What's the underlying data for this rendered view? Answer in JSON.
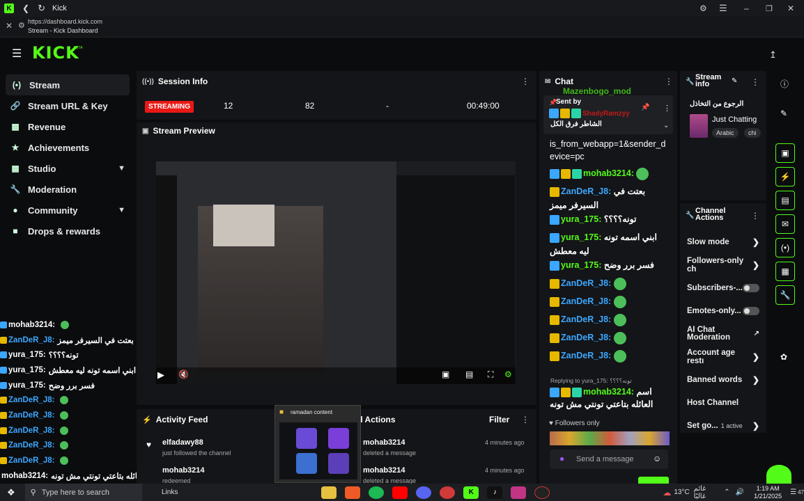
{
  "browser": {
    "tab_title": "Kick",
    "url": "https://dashboard.kick.com",
    "page_title": "Stream - Kick Dashboard"
  },
  "brand": {
    "logo": "KICK",
    "beta": "BETA",
    "accent": "#53fc18"
  },
  "sidebar": {
    "items": [
      {
        "label": "Stream",
        "icon": "broadcast-icon"
      },
      {
        "label": "Stream URL & Key",
        "icon": "link-icon"
      },
      {
        "label": "Revenue",
        "icon": "chart-icon"
      },
      {
        "label": "Achievements",
        "icon": "trophy-icon"
      },
      {
        "label": "Studio",
        "icon": "grid-icon"
      },
      {
        "label": "Moderation",
        "icon": "wrench-icon"
      },
      {
        "label": "Community",
        "icon": "users-icon"
      },
      {
        "label": "Drops & rewards",
        "icon": "gift-icon"
      }
    ]
  },
  "overlay_chat": [
    {
      "user": "mohab3214:",
      "msg": ""
    },
    {
      "user": "ZanDeR_J8:",
      "msg": "بعتت في السيرفر ميمز"
    },
    {
      "user": "yura_175:",
      "msg": "تونه؟؟؟؟"
    },
    {
      "user": "yura_175:",
      "msg": "ابني اسمه تونه ليه معطش"
    },
    {
      "user": "yura_175:",
      "msg": "فسر برر وضح"
    },
    {
      "user": "ZanDeR_J8:",
      "msg": ""
    },
    {
      "user": "ZanDeR_J8:",
      "msg": ""
    },
    {
      "user": "ZanDeR_J8:",
      "msg": ""
    },
    {
      "user": "ZanDeR_J8:",
      "msg": ""
    },
    {
      "user": "ZanDeR_J8:",
      "msg": ""
    },
    {
      "user": "mohab3214:",
      "msg": "العائله بتاعتي تونتي مش تونه"
    }
  ],
  "session_info": {
    "title": "Session Info",
    "status": "STREAMING",
    "viewers": "12",
    "followers": "82",
    "dash": "-",
    "duration": "00:49:00"
  },
  "stream_preview": {
    "title": "Stream Preview"
  },
  "activity_feed": {
    "title": "Activity Feed",
    "filter": "Filter",
    "items": [
      {
        "user": "elfadawy88",
        "action": "just followed the channel"
      },
      {
        "user": "mohab3214",
        "action": "redeemed"
      }
    ]
  },
  "mod_actions": {
    "title": "od Actions",
    "items": [
      {
        "user": "mohab3214",
        "action": "deleted a message",
        "time": "4 minutes ago"
      },
      {
        "user": "mohab3214",
        "action": "deleted a message",
        "time": "4 minutes ago"
      }
    ]
  },
  "popup": {
    "title": "ramadan content"
  },
  "chat": {
    "title": "Chat",
    "top_user": "Mazenbogo_mod",
    "pinned_label": "Sent by",
    "pinned_user": "ShadyRamzyy",
    "pinned_msg": "الشاطر فرق الكل",
    "link_text": "is_from_webapp=1&sender_device=pc",
    "messages": [
      {
        "user": "mohab3214:",
        "msg": "",
        "color": "#53fc18"
      },
      {
        "user": "ZanDeR_J8:",
        "msg": "بعتت في السيرفر ميمز",
        "color": "#3ba7ff"
      },
      {
        "user": "yura_175:",
        "msg": "تونه؟؟؟؟",
        "color": "#53fc18"
      },
      {
        "user": "yura_175:",
        "msg": "ابني اسمه تونه ليه معطش",
        "color": "#53fc18"
      },
      {
        "user": "yura_175:",
        "msg": "فسر برر وضح",
        "color": "#53fc18"
      },
      {
        "user": "ZanDeR_J8:",
        "msg": "",
        "color": "#3ba7ff"
      },
      {
        "user": "ZanDeR_J8:",
        "msg": "",
        "color": "#3ba7ff"
      },
      {
        "user": "ZanDeR_J8:",
        "msg": "",
        "color": "#3ba7ff"
      },
      {
        "user": "ZanDeR_J8:",
        "msg": "",
        "color": "#3ba7ff"
      },
      {
        "user": "ZanDeR_J8:",
        "msg": "",
        "color": "#3ba7ff"
      }
    ],
    "reply_label": "Replying to yura_175: تونه؟؟؟؟",
    "reply_user": "mohab3214:",
    "reply_msg": "اسم العائله بتاعتي تونتي مش تونه",
    "followers_only": "Followers only",
    "send_placeholder": "Send a message"
  },
  "stream_info": {
    "title": "Stream info",
    "stream_title": "الرجوع من التخاذل",
    "category": "Just Chatting",
    "tags": [
      "Arabic",
      "chi"
    ]
  },
  "channel_actions": {
    "title": "Channel Actions",
    "items": [
      {
        "label": "Slow mode",
        "kind": "arrow"
      },
      {
        "label": "Followers-only ch",
        "kind": "arrow"
      },
      {
        "label": "Subscribers-...",
        "kind": "toggle"
      },
      {
        "label": "Emotes-only...",
        "kind": "toggle"
      },
      {
        "label": "AI Chat Moderation",
        "kind": "ext"
      },
      {
        "label": "Account age restı",
        "kind": "arrow"
      },
      {
        "label": "Banned words",
        "kind": "arrow"
      },
      {
        "label": "Host Channel",
        "kind": "none"
      },
      {
        "label": "Set go...",
        "kind": "active",
        "extra": "1 active"
      }
    ]
  },
  "taskbar": {
    "search": "Type here to search",
    "links": "Links",
    "weather": "13°C",
    "weather_text": "غائم غالبًا",
    "time": "1:19 AM",
    "date": "1/21/2025",
    "notif": "47"
  }
}
